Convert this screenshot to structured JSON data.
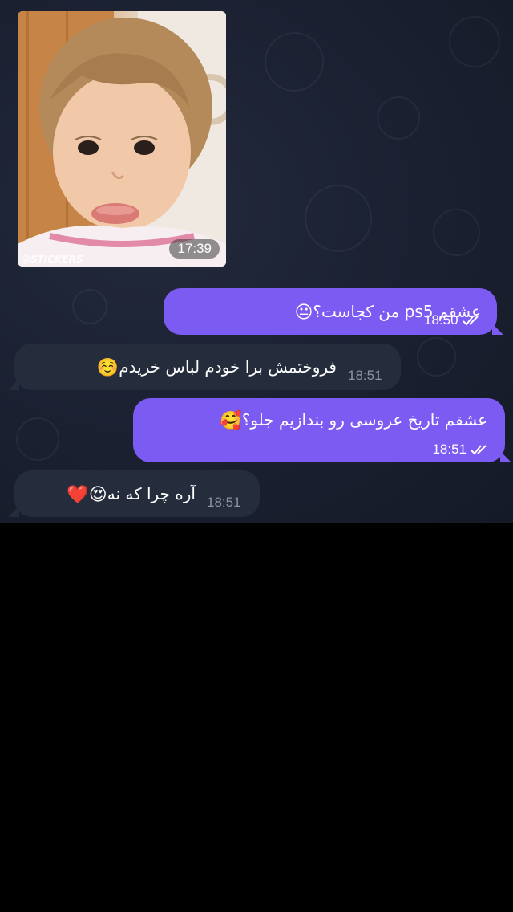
{
  "colors": {
    "outgoing_bubble": "#7b5bf2",
    "incoming_bubble": "#252c3b",
    "chat_background": "#1a2030",
    "screen_background": "#000000",
    "incoming_time": "#8b93a5"
  },
  "sticker": {
    "watermark": "@STICKERS",
    "time": "17:39",
    "icon": "crying-baby-sticker"
  },
  "messages": [
    {
      "direction": "outgoing",
      "text": "عشقم ps5 من کجاست؟",
      "emoji": "😐",
      "emoji_name": "neutral-face-icon",
      "time": "18:50",
      "read": true
    },
    {
      "direction": "incoming",
      "text": "فروختمش برا خودم لباس خریدم",
      "emoji": "☺️",
      "emoji_name": "smiling-face-icon",
      "time": "18:51"
    },
    {
      "direction": "outgoing",
      "text": "عشقم تاریخ عروسی رو بندازیم جلو؟",
      "emoji": "🥰",
      "emoji_name": "smiling-face-with-hearts-icon",
      "time": "18:51",
      "read": true
    },
    {
      "direction": "incoming",
      "text": "آره چرا که نه",
      "emoji": "😍❤️",
      "emoji_name": "heart-eyes-and-red-heart-icon",
      "time": "18:51"
    }
  ]
}
